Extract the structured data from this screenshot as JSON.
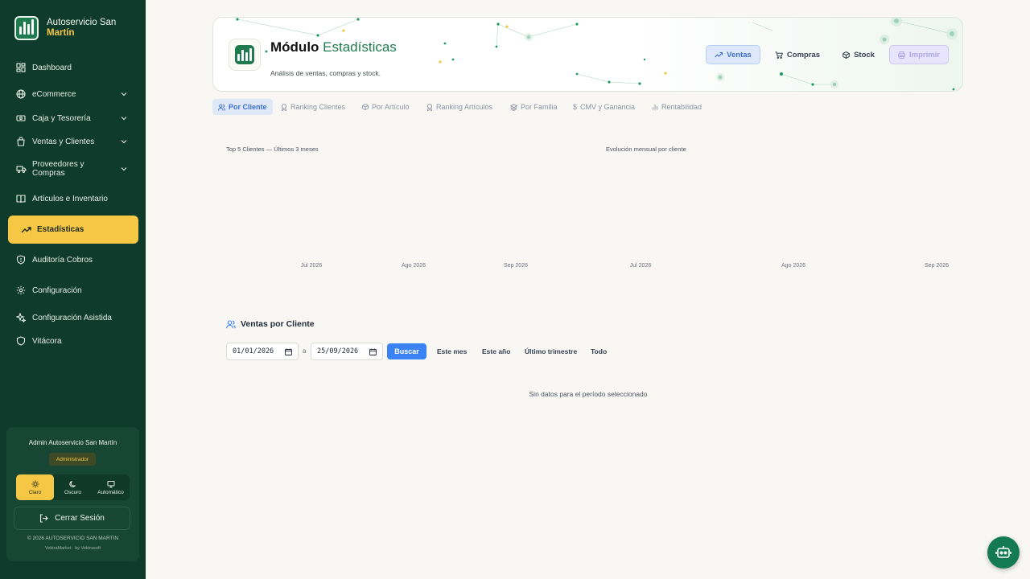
{
  "brand": {
    "line1": "Autoservicio San",
    "line2": "Martín"
  },
  "nav": [
    {
      "label": "Dashboard",
      "icon": "dashboard-icon"
    },
    {
      "label": "eCommerce",
      "icon": "globe-icon",
      "expandable": true
    },
    {
      "label": "Caja y Tesorería",
      "icon": "cash-icon",
      "expandable": true
    },
    {
      "label": "Ventas y Clientes",
      "icon": "bag-icon",
      "expandable": true
    },
    {
      "label": "Proveedores y Compras",
      "icon": "truck-icon",
      "expandable": true
    },
    {
      "label": "Artículos e Inventario",
      "icon": "book-icon"
    },
    {
      "label": "Estadísticas",
      "icon": "trending-up-icon",
      "active": true
    },
    {
      "label": "Auditoría Cobros",
      "icon": "shield-icon"
    },
    {
      "label": "Configuración",
      "icon": "gear-icon"
    },
    {
      "label": "Configuración Asistida",
      "icon": "sparkles-icon"
    },
    {
      "label": "Vitácora",
      "icon": "shield-icon"
    }
  ],
  "user": {
    "name": "Admin Autoservicio San Martín",
    "role": "Administrador",
    "themes": [
      {
        "label": "Claro",
        "active": true
      },
      {
        "label": "Oscuro"
      },
      {
        "label": "Automático"
      }
    ],
    "logout": "Cerrar Sesión",
    "copyright": "© 2026 AUTOSERVICIO SAN MARTIN",
    "credits": "VektraMarket · by Vektrasoft"
  },
  "header": {
    "title_main": "Módulo",
    "title_accent": "Estadísticas",
    "subtitle": "Análisis de ventas, compras y stock.",
    "buttons": {
      "ventas": "Ventas",
      "compras": "Compras",
      "stock": "Stock",
      "imprimir": "Imprimir"
    }
  },
  "tabs": [
    {
      "label": "Por Cliente",
      "active": true
    },
    {
      "label": "Ranking Clientes"
    },
    {
      "label": "Por Artículo"
    },
    {
      "label": "Ranking Artículos"
    },
    {
      "label": "Por Familia"
    },
    {
      "label": "CMV y Ganancia"
    },
    {
      "label": "Rentabilidad"
    }
  ],
  "chart_data": [
    {
      "type": "bar",
      "title": "Top 5 Clientes — Últimos 3 meses",
      "categories": [
        "Jul 2026",
        "Ago 2026",
        "Sep 2026"
      ],
      "series": []
    },
    {
      "type": "line",
      "title": "Evolución mensual por cliente",
      "categories": [
        "Jul 2026",
        "Ago 2026",
        "Sep 2026"
      ],
      "series": []
    }
  ],
  "section": {
    "title": "Ventas por Cliente",
    "date_from": "01/01/2026",
    "date_sep": "a",
    "date_to": "25/09/2026",
    "search": "Buscar",
    "quick": [
      "Este mes",
      "Este año",
      "Último trimestre",
      "Todo"
    ],
    "empty": "Sin datos para el período seleccionado"
  },
  "colors": {
    "sidebar": "#0f3b2c",
    "accent_yellow": "#f6c744",
    "brand_green": "#1f7a4f",
    "primary_blue": "#3b82f6"
  }
}
